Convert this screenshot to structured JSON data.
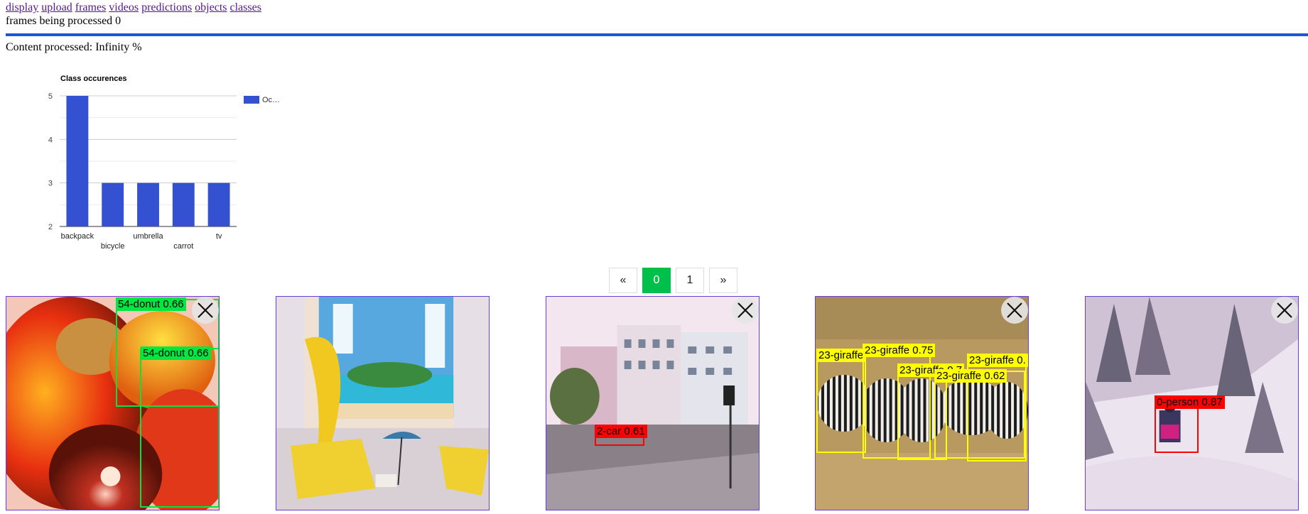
{
  "nav": {
    "links": [
      "display",
      "upload",
      "frames",
      "videos",
      "predictions",
      "objects",
      "classes"
    ]
  },
  "status": {
    "frames_processing": "frames being processed 0",
    "content_processed": "Content processed: Infinity %"
  },
  "chart_data": {
    "type": "bar",
    "title": "Class occurences",
    "categories": [
      "backpack",
      "bicycle",
      "umbrella",
      "carrot",
      "tv"
    ],
    "series": [
      {
        "name": "Oc…",
        "values": [
          5,
          3,
          3,
          3,
          3
        ]
      }
    ],
    "ylim": [
      2,
      5
    ],
    "yticks": [
      "2",
      "3",
      "4",
      "5"
    ],
    "grid": true,
    "legend_position": "right",
    "color": "#3451d1"
  },
  "pagination": {
    "prev": "«",
    "pages": [
      "0",
      "1"
    ],
    "active": "0",
    "next": "»"
  },
  "images": [
    {
      "name": "fruit",
      "labels": [
        {
          "text": "54-donut 0.66",
          "color": "#00e640"
        },
        {
          "text": "54-donut 0.66",
          "color": "#00e640"
        }
      ]
    },
    {
      "name": "banana-beach",
      "labels": []
    },
    {
      "name": "street",
      "labels": [
        {
          "text": "2-car 0.61",
          "color": "#ff0000"
        }
      ]
    },
    {
      "name": "zebras",
      "labels": [
        {
          "text": "23-giraffe",
          "color": "#ffff00"
        },
        {
          "text": "23-giraffe 0.75",
          "color": "#ffff00"
        },
        {
          "text": "23-giraffe 0.7",
          "color": "#ffff00"
        },
        {
          "text": "23-giraffe 0.62",
          "color": "#ffff00"
        },
        {
          "text": "23-giraffe 0.",
          "color": "#ffff00"
        }
      ]
    },
    {
      "name": "snow-person",
      "labels": [
        {
          "text": "0-person 0.87",
          "color": "#ff0000"
        }
      ]
    }
  ],
  "icons": {
    "close": "close-icon"
  }
}
